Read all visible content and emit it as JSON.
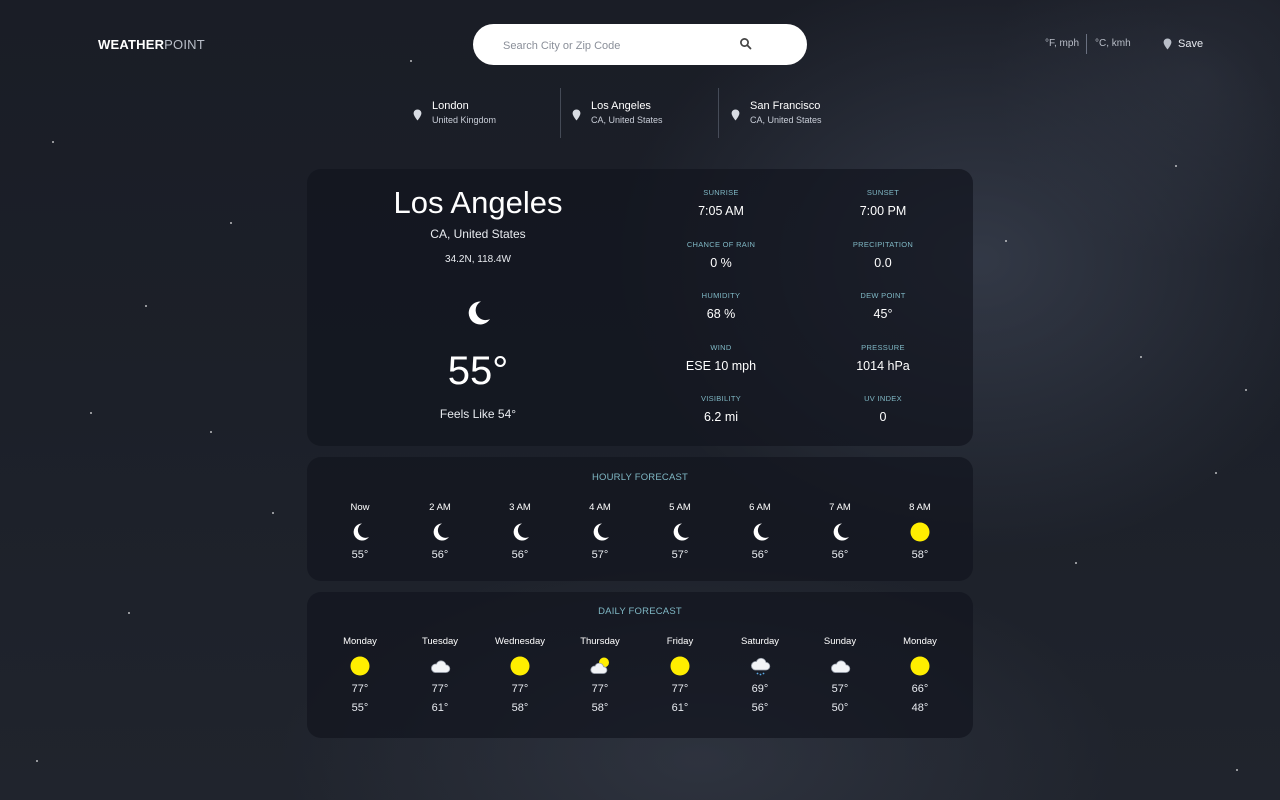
{
  "brand": {
    "bold": "WEATHER",
    "light": "POINT"
  },
  "search": {
    "placeholder": "Search City or Zip Code"
  },
  "units": {
    "imperial": "°F, mph",
    "metric": "°C, kmh"
  },
  "save_label": "Save",
  "saved_locations": [
    {
      "name": "London",
      "sub": "United Kingdom"
    },
    {
      "name": "Los Angeles",
      "sub": "CA, United States"
    },
    {
      "name": "San Francisco",
      "sub": "CA, United States"
    }
  ],
  "current": {
    "city": "Los Angeles",
    "region": "CA, United States",
    "coords": "34.2N, 118.4W",
    "icon": "moon-icon",
    "temp": "55°",
    "feels": "Feels Like 54°"
  },
  "stats": [
    {
      "label": "SUNRISE",
      "value": "7:05 AM"
    },
    {
      "label": "SUNSET",
      "value": "7:00 PM"
    },
    {
      "label": "CHANCE OF RAIN",
      "value": "0 %"
    },
    {
      "label": "PRECIPITATION",
      "value": "0.0"
    },
    {
      "label": "HUMIDITY",
      "value": "68 %"
    },
    {
      "label": "DEW POINT",
      "value": "45°"
    },
    {
      "label": "WIND",
      "value": "ESE 10 mph"
    },
    {
      "label": "PRESSURE",
      "value": "1014 hPa"
    },
    {
      "label": "VISIBILITY",
      "value": "6.2 mi"
    },
    {
      "label": "UV INDEX",
      "value": "0"
    }
  ],
  "hourly": {
    "title": "HOURLY FORECAST",
    "items": [
      {
        "time": "Now",
        "icon": "moon-icon",
        "temp": "55°"
      },
      {
        "time": "2 AM",
        "icon": "moon-icon",
        "temp": "56°"
      },
      {
        "time": "3 AM",
        "icon": "moon-icon",
        "temp": "56°"
      },
      {
        "time": "4 AM",
        "icon": "moon-icon",
        "temp": "57°"
      },
      {
        "time": "5 AM",
        "icon": "moon-icon",
        "temp": "57°"
      },
      {
        "time": "6 AM",
        "icon": "moon-icon",
        "temp": "56°"
      },
      {
        "time": "7 AM",
        "icon": "moon-icon",
        "temp": "56°"
      },
      {
        "time": "8 AM",
        "icon": "sun-icon",
        "temp": "58°"
      }
    ]
  },
  "daily": {
    "title": "DAILY FORECAST",
    "items": [
      {
        "day": "Monday",
        "icon": "sun-icon",
        "high": "77°",
        "low": "55°"
      },
      {
        "day": "Tuesday",
        "icon": "cloud-icon",
        "high": "77°",
        "low": "61°"
      },
      {
        "day": "Wednesday",
        "icon": "sun-icon",
        "high": "77°",
        "low": "58°"
      },
      {
        "day": "Thursday",
        "icon": "partly-cloudy-icon",
        "high": "77°",
        "low": "58°"
      },
      {
        "day": "Friday",
        "icon": "sun-icon",
        "high": "77°",
        "low": "61°"
      },
      {
        "day": "Saturday",
        "icon": "rain-cloud-icon",
        "high": "69°",
        "low": "56°"
      },
      {
        "day": "Sunday",
        "icon": "cloud-icon",
        "high": "57°",
        "low": "50°"
      },
      {
        "day": "Monday",
        "icon": "sun-icon",
        "high": "66°",
        "low": "48°"
      }
    ]
  },
  "colors": {
    "accent": "#7fb7c4",
    "sun": "#ffee00",
    "card": "#12151e"
  }
}
